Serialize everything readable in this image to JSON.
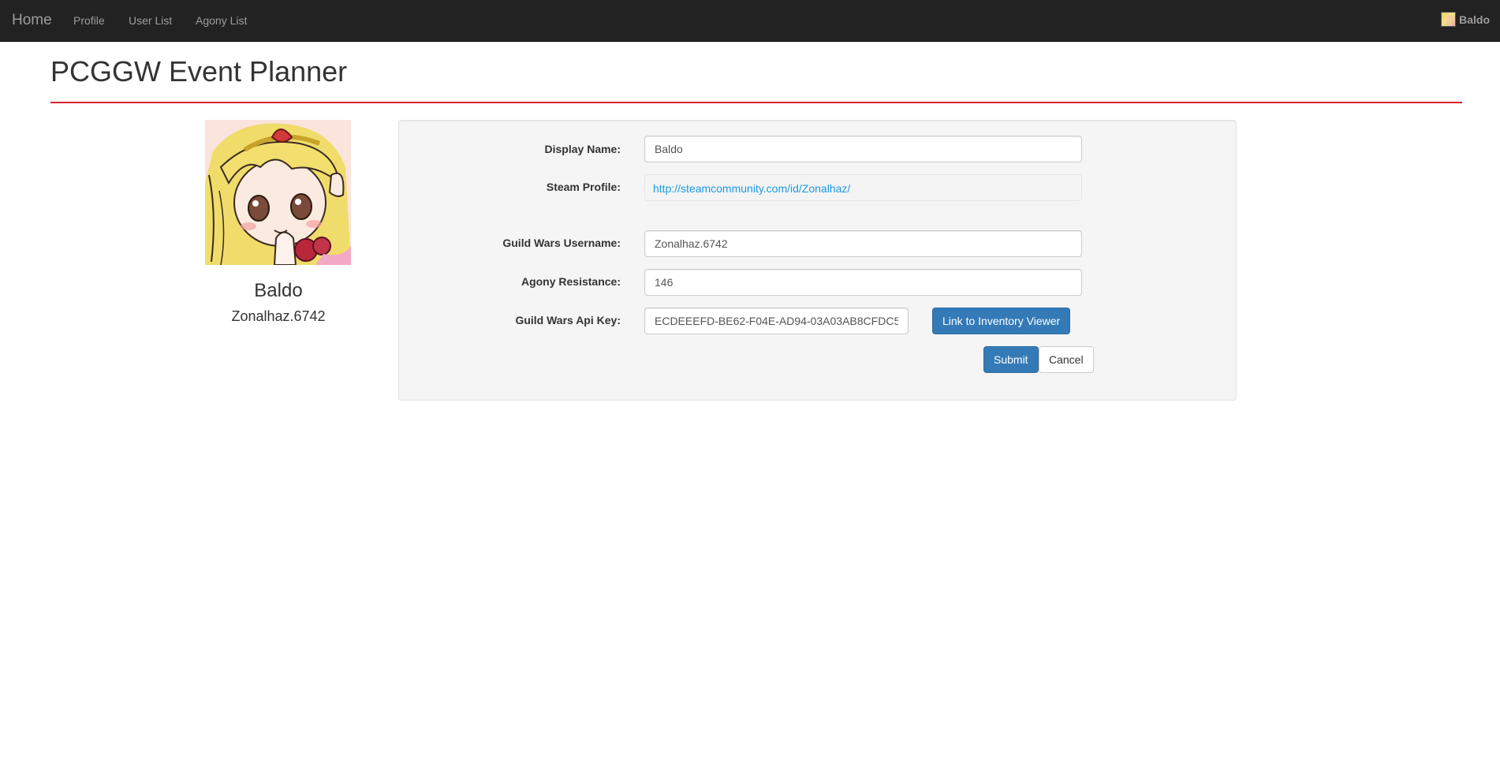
{
  "navbar": {
    "brand": "Home",
    "links": [
      "Profile",
      "User List",
      "Agony List"
    ],
    "user_name": "Baldo"
  },
  "header": {
    "title": "PCGGW Event Planner"
  },
  "profile": {
    "display_name": "Baldo",
    "username": "Zonalhaz.6742"
  },
  "form": {
    "display_name_label": "Display Name:",
    "display_name_value": "Baldo",
    "steam_profile_label": "Steam Profile:",
    "steam_profile_url": "http://steamcommunity.com/id/Zonalhaz/",
    "gw_username_label": "Guild Wars Username:",
    "gw_username_value": "Zonalhaz.6742",
    "agony_label": "Agony Resistance:",
    "agony_value": "146",
    "api_key_label": "Guild Wars Api Key:",
    "api_key_value": "ECDEEEFD-BE62-F04E-AD94-03A03AB8CFDC5",
    "inventory_button": "Link to Inventory Viewer",
    "submit_button": "Submit",
    "cancel_button": "Cancel"
  },
  "colors": {
    "navbar_bg": "#222222",
    "title_rule": "#d9232c",
    "primary": "#337ab7",
    "link": "#1a9be6"
  }
}
